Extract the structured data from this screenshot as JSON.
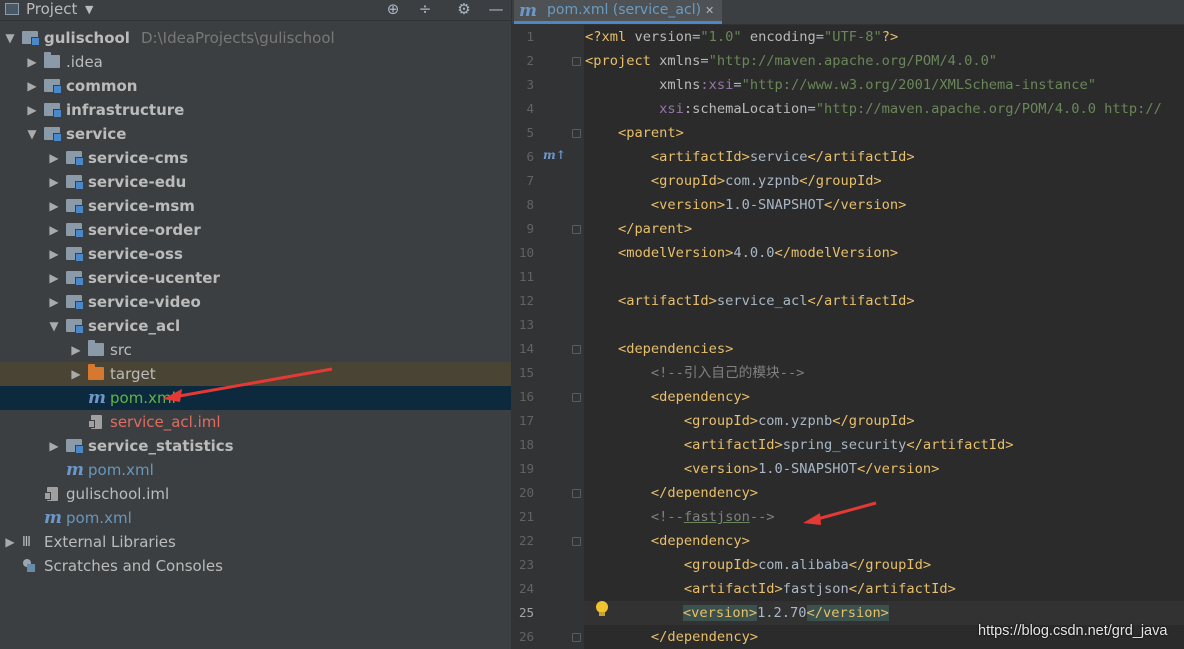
{
  "project_panel": {
    "title": "Project",
    "dropdown_glyph": "▼",
    "header_icons": [
      "locate-icon",
      "collapse-all-icon",
      "settings-gear-icon",
      "hide-icon"
    ],
    "tree": [
      {
        "label": "gulischool",
        "path": "D:\\IdeaProjects\\gulischool",
        "icon": "module-folder-icon",
        "expanded": true
      },
      {
        "label": ".idea",
        "icon": "folder-icon",
        "expanded": false
      },
      {
        "label": "common",
        "icon": "module-folder-icon",
        "expanded": false
      },
      {
        "label": "infrastructure",
        "icon": "module-folder-icon",
        "expanded": false
      },
      {
        "label": "service",
        "icon": "module-folder-icon",
        "expanded": true
      },
      {
        "label": "service-cms",
        "icon": "module-folder-icon",
        "expanded": false
      },
      {
        "label": "service-edu",
        "icon": "module-folder-icon",
        "expanded": false
      },
      {
        "label": "service-msm",
        "icon": "module-folder-icon",
        "expanded": false
      },
      {
        "label": "service-order",
        "icon": "module-folder-icon",
        "expanded": false
      },
      {
        "label": "service-oss",
        "icon": "module-folder-icon",
        "expanded": false
      },
      {
        "label": "service-ucenter",
        "icon": "module-folder-icon",
        "expanded": false
      },
      {
        "label": "service-video",
        "icon": "module-folder-icon",
        "expanded": false
      },
      {
        "label": "service_acl",
        "icon": "module-folder-icon",
        "expanded": true
      },
      {
        "label": "src",
        "icon": "folder-icon",
        "expanded": false
      },
      {
        "label": "target",
        "icon": "excluded-folder-icon",
        "expanded": false
      },
      {
        "label": "pom.xml",
        "icon": "maven-icon",
        "selected": true
      },
      {
        "label": "service_acl.iml",
        "icon": "iml-file-icon"
      },
      {
        "label": "service_statistics",
        "icon": "module-folder-icon",
        "expanded": false
      },
      {
        "label": "pom.xml",
        "icon": "maven-icon"
      },
      {
        "label": "gulischool.iml",
        "icon": "iml-file-icon"
      },
      {
        "label": "pom.xml",
        "icon": "maven-icon"
      },
      {
        "label": "External Libraries",
        "icon": "libraries-icon",
        "expanded": false
      },
      {
        "label": "Scratches and Consoles",
        "icon": "scratches-icon"
      }
    ]
  },
  "editor": {
    "tab": {
      "label": "pom.xml (service_acl)",
      "icon": "maven-icon",
      "close_glyph": "✕"
    },
    "gutter_marker": "m↑",
    "current_line": 25,
    "lines": [
      {
        "n": "1",
        "parts": [
          [
            "t",
            "<?xml "
          ],
          [
            "a",
            "version"
          ],
          [
            "tx",
            "="
          ],
          [
            "s",
            "\"1.0\""
          ],
          [
            "a",
            " encoding"
          ],
          [
            "tx",
            "="
          ],
          [
            "s",
            "\"UTF-8\""
          ],
          [
            "t",
            "?>"
          ]
        ]
      },
      {
        "n": "2",
        "parts": [
          [
            "t",
            "<project "
          ],
          [
            "a",
            "xmlns"
          ],
          [
            "tx",
            "="
          ],
          [
            "s",
            "\"http://maven.apache.org/POM/4.0.0\""
          ]
        ]
      },
      {
        "n": "3",
        "parts": [
          [
            "a",
            "         xmlns"
          ],
          [
            "ns",
            ":xsi"
          ],
          [
            "tx",
            "="
          ],
          [
            "s",
            "\"http://www.w3.org/2001/XMLSchema-instance\""
          ]
        ]
      },
      {
        "n": "4",
        "parts": [
          [
            "ns",
            "         xsi"
          ],
          [
            "a",
            ":schemaLocation"
          ],
          [
            "tx",
            "="
          ],
          [
            "s",
            "\"http://maven.apache.org/POM/4.0.0 http://"
          ]
        ]
      },
      {
        "n": "5",
        "parts": [
          [
            "t",
            "    <parent>"
          ]
        ]
      },
      {
        "n": "6",
        "parts": [
          [
            "t",
            "        <artifactId>"
          ],
          [
            "tx",
            "service"
          ],
          [
            "t",
            "</artifactId>"
          ]
        ]
      },
      {
        "n": "7",
        "parts": [
          [
            "t",
            "        <groupId>"
          ],
          [
            "tx",
            "com.yzpnb"
          ],
          [
            "t",
            "</groupId>"
          ]
        ]
      },
      {
        "n": "8",
        "parts": [
          [
            "t",
            "        <version>"
          ],
          [
            "tx",
            "1.0-SNAPSHOT"
          ],
          [
            "t",
            "</version>"
          ]
        ]
      },
      {
        "n": "9",
        "parts": [
          [
            "t",
            "    </parent>"
          ]
        ]
      },
      {
        "n": "10",
        "parts": [
          [
            "t",
            "    <modelVersion>"
          ],
          [
            "tx",
            "4.0.0"
          ],
          [
            "t",
            "</modelVersion>"
          ]
        ]
      },
      {
        "n": "11",
        "parts": []
      },
      {
        "n": "12",
        "parts": [
          [
            "t",
            "    <artifactId>"
          ],
          [
            "tx",
            "service_acl"
          ],
          [
            "t",
            "</artifactId>"
          ]
        ]
      },
      {
        "n": "13",
        "parts": []
      },
      {
        "n": "14",
        "parts": [
          [
            "t",
            "    <dependencies>"
          ]
        ]
      },
      {
        "n": "15",
        "parts": [
          [
            "cm",
            "        <!--引入自己的模块-->"
          ]
        ]
      },
      {
        "n": "16",
        "parts": [
          [
            "t",
            "        <dependency>"
          ]
        ]
      },
      {
        "n": "17",
        "parts": [
          [
            "t",
            "            <groupId>"
          ],
          [
            "tx",
            "com.yzpnb"
          ],
          [
            "t",
            "</groupId>"
          ]
        ]
      },
      {
        "n": "18",
        "parts": [
          [
            "t",
            "            <artifactId>"
          ],
          [
            "tx",
            "spring_security"
          ],
          [
            "t",
            "</artifactId>"
          ]
        ]
      },
      {
        "n": "19",
        "parts": [
          [
            "t",
            "            <version>"
          ],
          [
            "tx",
            "1.0-SNAPSHOT"
          ],
          [
            "t",
            "</version>"
          ]
        ]
      },
      {
        "n": "20",
        "parts": [
          [
            "t",
            "        </dependency>"
          ]
        ]
      },
      {
        "n": "21",
        "parts": [
          [
            "cm",
            "        <!--"
          ],
          [
            "cmu",
            "fastjson"
          ],
          [
            "cm",
            "-->"
          ]
        ]
      },
      {
        "n": "22",
        "parts": [
          [
            "t",
            "        <dependency>"
          ]
        ]
      },
      {
        "n": "23",
        "parts": [
          [
            "t",
            "            <groupId>"
          ],
          [
            "tx",
            "com.alibaba"
          ],
          [
            "t",
            "</groupId>"
          ]
        ]
      },
      {
        "n": "24",
        "parts": [
          [
            "t",
            "            <artifactId>"
          ],
          [
            "tx",
            "fastjson"
          ],
          [
            "t",
            "</artifactId>"
          ]
        ]
      },
      {
        "n": "25",
        "parts": [
          [
            "tx",
            "            "
          ],
          [
            "thl",
            "<version>"
          ],
          [
            "tx",
            "1.2.70"
          ],
          [
            "thl",
            "</version>"
          ]
        ]
      },
      {
        "n": "26",
        "parts": [
          [
            "t",
            "        </dependency>"
          ]
        ]
      }
    ]
  },
  "annotations": {
    "color": "#e53935",
    "count": 2
  },
  "watermark": "https://blog.csdn.net/grd_java"
}
